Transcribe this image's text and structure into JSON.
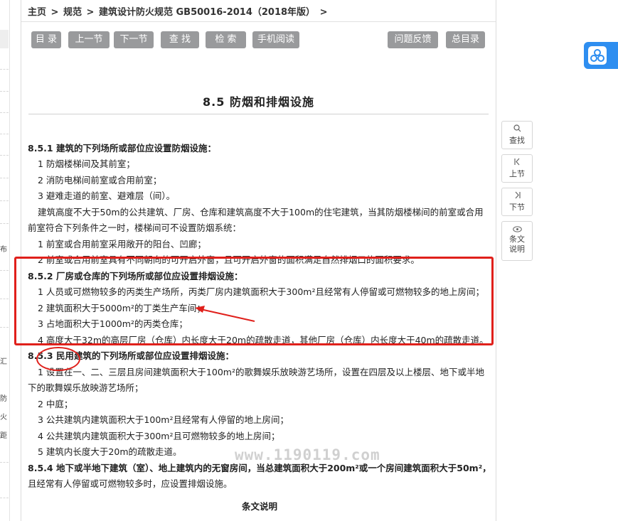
{
  "breadcrumb": {
    "home": "主页",
    "sep1": ">",
    "spec": "规范",
    "sep2": ">",
    "doc": "建筑设计防火规范 GB50016-2014（2018年版）",
    "sep3": ">"
  },
  "toolbar": {
    "toc": "目 录",
    "prev": "上一节",
    "next": "下一节",
    "find": "查 找",
    "search": "检 索",
    "mobile": "手机阅读",
    "feedback": "问题反馈",
    "index": "总目录"
  },
  "section_title": "8.5 防烟和排烟设施",
  "lines": [
    "8.5.1 建筑的下列场所或部位应设置防烟设施：",
    "1 防烟楼梯间及其前室；",
    "2 消防电梯间前室或合用前室；",
    "3 避难走道的前室、避难层（间）。",
    "建筑高度不大于50m的公共建筑、厂房、仓库和建筑高度不大于100m的住宅建筑，当其防烟楼梯间的前室或合用",
    "前室符合下列条件之一时，楼梯间可不设置防烟系统：",
    "1 前室或合用前室采用敞开的阳台、凹廊；",
    "2 前室或合用前室具有不同朝向的可开启外窗，且可开启外窗的面积满足自然排烟口的面积要求。",
    "8.5.2 厂房或仓库的下列场所或部位应设置排烟设施：",
    "1 人员或可燃物较多的丙类生产场所，丙类厂房内建筑面积大于300m²且经常有人停留或可燃物较多的地上房间；",
    "2 建筑面积大于5000m²的丁类生产车间；",
    "3 占地面积大于1000m²的丙类仓库；",
    "4 高度大于32m的高层厂房（仓库）内长度大于20m的疏散走道，其他厂房（仓库）内长度大于40m的疏散走道。",
    "8.5.3 民用建筑的下列场所或部位应设置排烟设施：",
    "1 设置在一、二、三层且房间建筑面积大于100m²的歌舞娱乐放映游艺场所，设置在四层及以上楼层、地下或半地",
    "下的歌舞娱乐放映游艺场所；",
    "2 中庭；",
    "3 公共建筑内建筑面积大于100m²且经常有人停留的地上房间；",
    "4 公共建筑内建筑面积大于300m²且可燃物较多的地上房间；",
    "5 建筑内长度大于20m的疏散走道。",
    "8.5.4 地下或半地下建筑（室）、地上建筑内的无窗房间，当总建筑面积大于200m²或一个房间建筑面积大于50m²，",
    "且经常有人停留或可燃物较多时，应设置排烟设施。",
    "条文说明"
  ],
  "side_tools": {
    "find": "查找",
    "prev": "上节",
    "next": "下节",
    "explain_1": "条文",
    "explain_2": "说明",
    "find_icon": "search-icon",
    "prev_icon": "chevron-up-bar-icon",
    "next_icon": "chevron-down-bar-icon",
    "explain_icon": "eye-icon"
  },
  "left_strip": {
    "t1": "布",
    "t2": "汇",
    "t3": "防",
    "t4": "火",
    "t5": "距"
  },
  "watermark": "www.1190119.com",
  "colors": {
    "button_bg": "#999a9c",
    "annotation_red": "#e0201b",
    "app_blue": "#2e8ef0"
  }
}
